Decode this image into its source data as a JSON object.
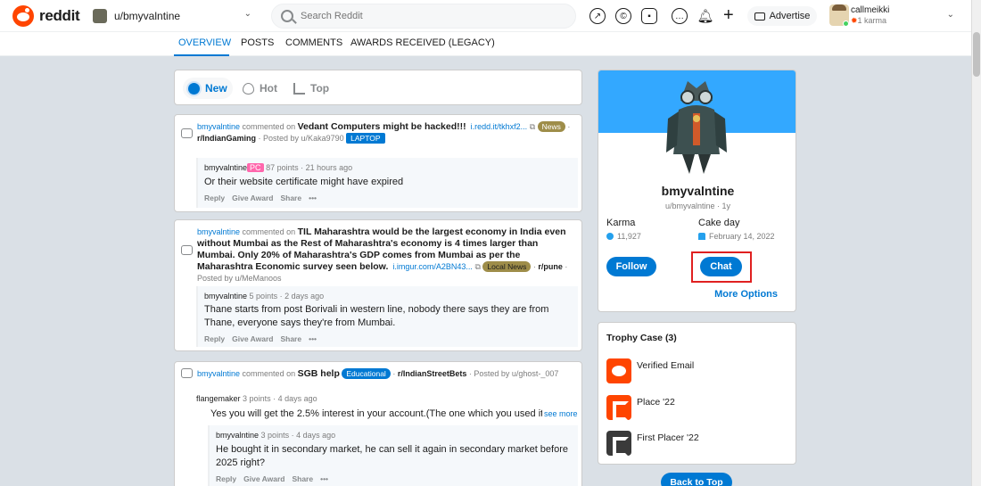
{
  "header": {
    "logo_text": "reddit",
    "username_switch": "u/bmyvalntine",
    "search_placeholder": "Search Reddit",
    "advertise_label": "Advertise",
    "account_name": "callmeikki",
    "account_karma": "1 karma"
  },
  "tabs": [
    "OVERVIEW",
    "POSTS",
    "COMMENTS",
    "AWARDS RECEIVED (LEGACY)"
  ],
  "sort": {
    "new": "New",
    "hot": "Hot",
    "top": "Top"
  },
  "posts": [
    {
      "user": "bmyvalntine",
      "commented_on": "commented on",
      "title": "Vedant Computers might be hacked!!!",
      "link": "i.redd.it/tkhxf2...",
      "flair": "News",
      "subreddit": "r/IndianGaming",
      "posted_by": "· Posted by u/Kaka9790",
      "sub_flair": "LAPTOP",
      "comment": {
        "user": "bmyvalntine",
        "badge": "PC",
        "points": "87 points · 21 hours ago",
        "body": "Or their website certificate might have expired"
      }
    },
    {
      "user": "bmyvalntine",
      "commented_on": "commented on",
      "title": "TIL Maharashtra would be the largest economy in India even without Mumbai as the Rest of Maharashtra's economy is 4 times larger than Mumbai. Only 20% of Maharashtra's GDP comes from Mumbai as per the Maharashtra Economic survey seen below.",
      "link": "i.imgur.com/A2BN43...",
      "flair": "Local News",
      "subreddit": "r/pune",
      "posted_by": "· Posted by u/MeManoos",
      "comment": {
        "user": "bmyvalntine",
        "points": "5 points · 2 days ago",
        "body": "Thane starts from post Borivali in western line, nobody there says they are from Thane, everyone says they're from Mumbai."
      }
    },
    {
      "user": "bmyvalntine",
      "commented_on": "commented on",
      "title": "SGB help",
      "flair": "Educational",
      "subreddit": "r/IndianStreetBets",
      "posted_by": "· Posted by u/ghost-_007",
      "parent": {
        "user": "flangemaker",
        "points": "3 points · 4 days ago",
        "body": "Yes you will get the 2.5% interest in your account.(The one which you used it to",
        "see_more": "see more"
      },
      "comment": {
        "user": "bmyvalntine",
        "points": "3 points · 4 days ago",
        "body": "He bought it in secondary market, he can sell it again in secondary market before 2025 right?"
      }
    }
  ],
  "actions": {
    "reply": "Reply",
    "give_award": "Give Award",
    "share": "Share",
    "more": "•••"
  },
  "profile": {
    "name": "bmyvalntine",
    "handle": "u/bmyvalntine · 1y",
    "karma_label": "Karma",
    "karma_value": "11,927",
    "cake_label": "Cake day",
    "cake_value": "February 14, 2022",
    "follow": "Follow",
    "chat": "Chat",
    "more_options": "More Options"
  },
  "trophies": {
    "title": "Trophy Case (3)",
    "items": [
      "Verified Email",
      "Place '22",
      "First Placer '22"
    ]
  },
  "back_to_top": "Back to Top",
  "colors": {
    "accent": "#0079d3",
    "brand": "#ff4500",
    "banner": "#33a8ff",
    "highlight": "#e02020"
  }
}
